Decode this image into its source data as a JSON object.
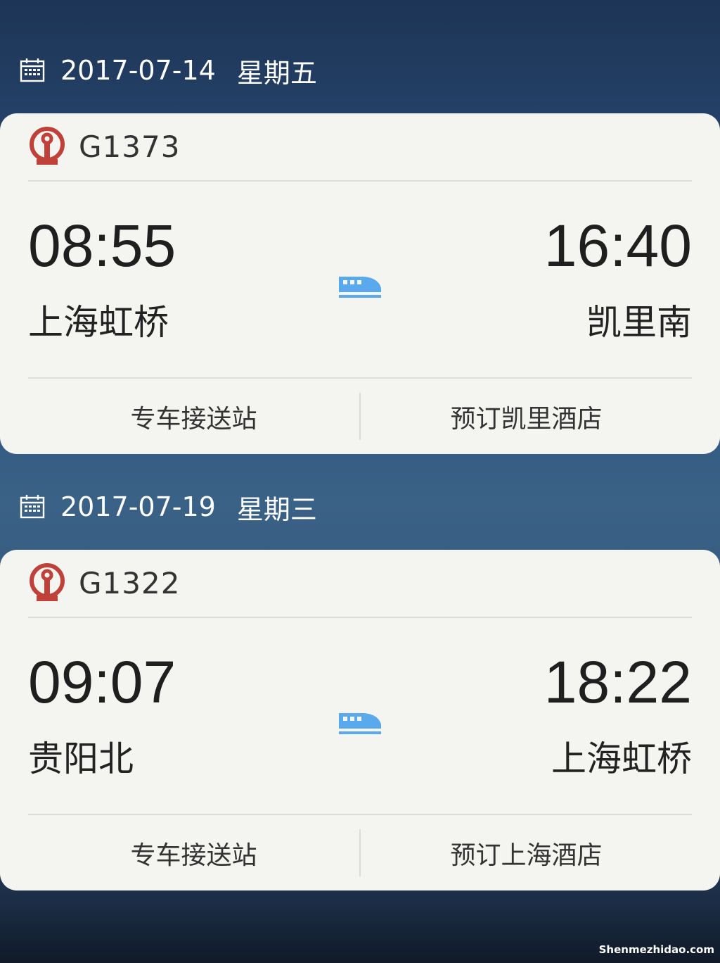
{
  "trips": [
    {
      "date": "2017-07-14",
      "weekday": "星期五",
      "train_no": "G1373",
      "depart_time": "08:55",
      "arrive_time": "16:40",
      "from_station": "上海虹桥",
      "to_station": "凯里南",
      "action_left": "专车接送站",
      "action_right": "预订凯里酒店"
    },
    {
      "date": "2017-07-19",
      "weekday": "星期三",
      "train_no": "G1322",
      "depart_time": "09:07",
      "arrive_time": "18:22",
      "from_station": "贵阳北",
      "to_station": "上海虹桥",
      "action_left": "专车接送站",
      "action_right": "预订上海酒店"
    }
  ],
  "watermark": "Shenmezhidao.com",
  "colors": {
    "logo_red": "#c0403a",
    "train_icon_blue": "#5aa9ec",
    "card_bg": "#f4f4f1"
  },
  "icons": {
    "date": "calendar-icon",
    "logo": "china-railway-logo-icon",
    "train": "high-speed-train-icon"
  }
}
